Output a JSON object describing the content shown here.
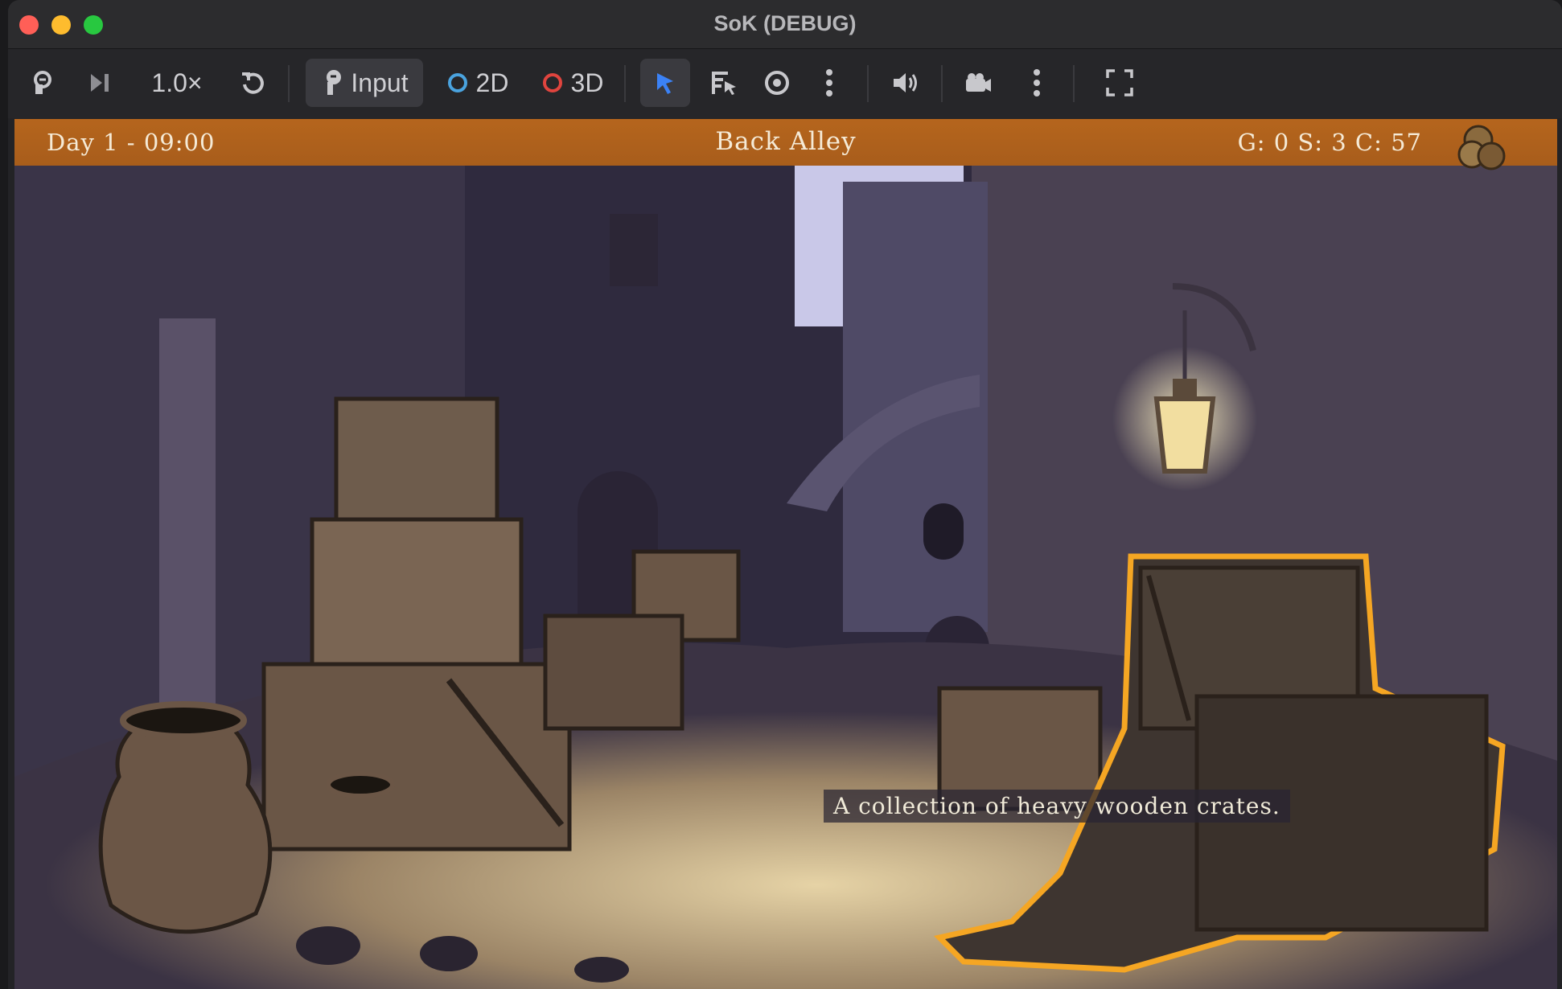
{
  "window": {
    "title": "SoK (DEBUG)"
  },
  "toolbar": {
    "speed_label": "1.0×",
    "input_label": "Input",
    "mode_2d_label": "2D",
    "mode_3d_label": "3D"
  },
  "hud": {
    "day_time": "Day 1 - 09:00",
    "location": "Back Alley",
    "money": "G: 0 S: 3 C: 57"
  },
  "hover_caption": "A collection of heavy wooden crates.",
  "colors": {
    "hud_bar": "#b5651d",
    "highlight_outline": "#f5a623",
    "mode_2d_ring": "#4aa3df",
    "mode_3d_ring": "#e0443e",
    "select_tool_accent": "#3b82f6"
  },
  "icons": [
    "remote-debug-icon",
    "step-frame-icon",
    "reset-icon",
    "input-icon",
    "cursor-select-icon",
    "list-select-icon",
    "eye-icon",
    "more-vert-icon",
    "speaker-icon",
    "camera-icon",
    "fullscreen-icon",
    "coins-icon"
  ]
}
